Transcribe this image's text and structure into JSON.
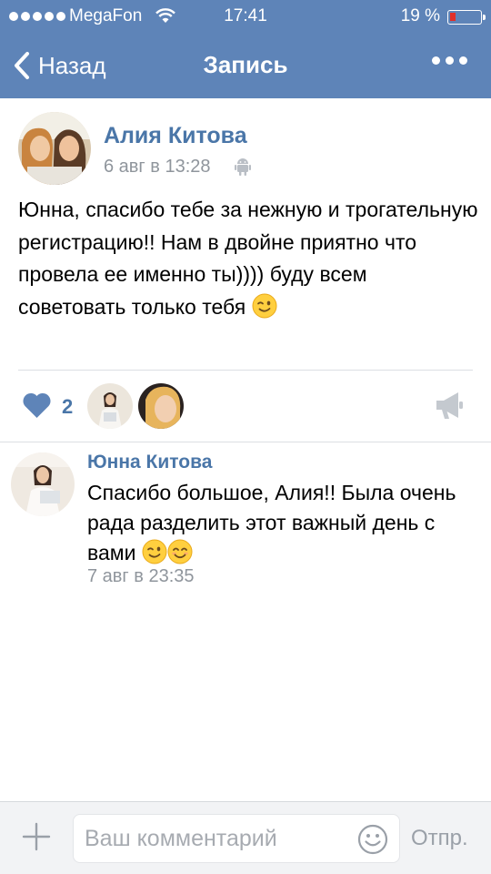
{
  "status_bar": {
    "carrier": "MegaFon",
    "time": "17:41",
    "battery": "19 %",
    "battery_level": 0.19,
    "battery_color": "#e0302a"
  },
  "nav": {
    "back_label": "Назад",
    "title": "Запись",
    "more_icon": "more-dots-icon"
  },
  "post": {
    "author": "Алия Китова",
    "date": "6 авг в 13:28",
    "platform_icon": "android-icon",
    "text": "Юнна, спасибо тебе за нежную и трогательную регистрацию!! Нам в двойне приятно что провела ее именно ты)))) буду всем советовать только тебя",
    "emoji": "wink-emoji",
    "likes_count": "2",
    "like_icon": "heart-icon",
    "share_icon": "megaphone-icon"
  },
  "comment": {
    "author": "Юнна Китова",
    "text": "Спасибо большое, Алия!! Была очень рада разделить этот важный день с вами",
    "emojis": [
      "wink-emoji",
      "smile-emoji"
    ],
    "date": "7 авг в 23:35"
  },
  "composer": {
    "attach_icon": "plus-icon",
    "placeholder": "Ваш комментарий",
    "value": "",
    "emoji_icon": "smile-icon",
    "send_label": "Отпр."
  },
  "colors": {
    "header": "#5e84b8",
    "link": "#4a76a8",
    "secondary_text": "#8f959c"
  }
}
